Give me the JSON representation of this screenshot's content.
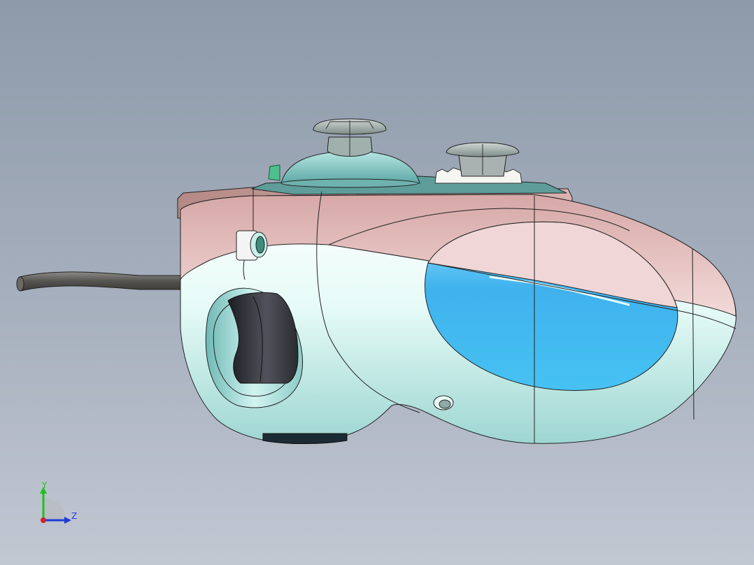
{
  "viewport": {
    "background_top": "#8e9aaa",
    "background_bottom": "#c2c8d2"
  },
  "model": {
    "subject": "game-controller",
    "body_colors": {
      "rose": "#e8c8c8",
      "mint": "#c9efe9",
      "teal": "#7fc3c0",
      "window_blue": "#41b4ec",
      "trigger_dark": "#36363e",
      "cable": "#5c5a56"
    }
  },
  "triad": {
    "y_label": "Y",
    "z_label": "Z",
    "y_color": "#1fc21f",
    "z_color": "#1e3cd6",
    "x_color": "#d4202a"
  }
}
